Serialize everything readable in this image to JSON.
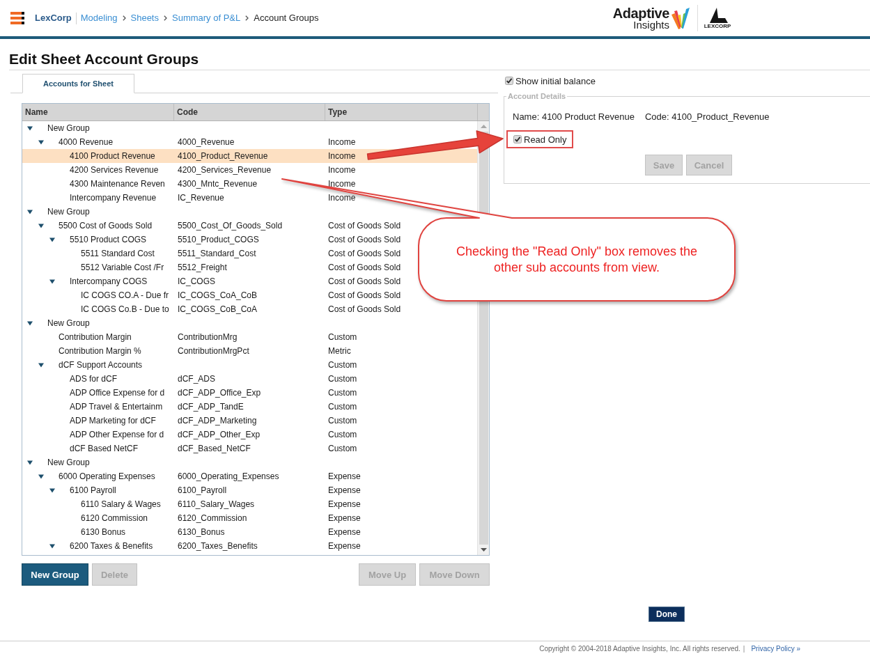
{
  "header": {
    "breadcrumbs": [
      {
        "label": "LexCorp",
        "kind": "home"
      },
      {
        "label": "Modeling",
        "kind": "link"
      },
      {
        "label": "Sheets",
        "kind": "link"
      },
      {
        "label": "Summary of P&L",
        "kind": "link"
      },
      {
        "label": "Account Groups",
        "kind": "current"
      }
    ],
    "brand_logo": {
      "line_1": "Adaptive",
      "line_2": "Insights"
    },
    "client_logo": {
      "text": "LEXCORP"
    }
  },
  "page_title": "Edit Sheet Account Groups",
  "tabs": [
    {
      "label": "Accounts for Sheet",
      "selected": true
    }
  ],
  "tree": {
    "columns": [
      "Name",
      "Code",
      "Type"
    ],
    "rows": [
      {
        "name": "New Group",
        "selected": false,
        "expanded": true,
        "children": [
          {
            "name": "4000 Revenue",
            "code": "4000_Revenue",
            "type": "Income",
            "selected": false,
            "expanded": true,
            "children": [
              {
                "name": "4100 Product Revenue",
                "code": "4100_Product_Revenue",
                "type": "Income",
                "selected": true
              },
              {
                "name": "4200 Services Revenue",
                "code": "4200_Services_Revenue",
                "type": "Income",
                "selected": false
              },
              {
                "name": "4300 Maintenance Reven",
                "code": "4300_Mntc_Revenue",
                "type": "Income",
                "selected": false
              },
              {
                "name": "Intercompany Revenue",
                "code": "IC_Revenue",
                "type": "Income",
                "selected": false
              }
            ]
          }
        ]
      },
      {
        "name": "New Group",
        "selected": false,
        "expanded": true,
        "children": [
          {
            "name": "5500 Cost of Goods Sold",
            "code": "5500_Cost_Of_Goods_Sold",
            "type": "Cost of Goods Sold",
            "selected": false,
            "expanded": true,
            "children": [
              {
                "name": "5510 Product COGS",
                "code": "5510_Product_COGS",
                "type": "Cost of Goods Sold",
                "selected": false,
                "expanded": true,
                "children": [
                  {
                    "name": "5511 Standard Cost",
                    "code": "5511_Standard_Cost",
                    "type": "Cost of Goods Sold",
                    "selected": false
                  },
                  {
                    "name": "5512 Variable Cost /Fr",
                    "code": "5512_Freight",
                    "type": "Cost of Goods Sold",
                    "selected": false
                  }
                ]
              },
              {
                "name": "Intercompany COGS",
                "code": "IC_COGS",
                "type": "Cost of Goods Sold",
                "selected": false,
                "expanded": true,
                "children": [
                  {
                    "name": "IC COGS CO.A - Due fr",
                    "code": "IC_COGS_CoA_CoB",
                    "type": "Cost of Goods Sold",
                    "selected": false
                  },
                  {
                    "name": "IC COGS Co.B - Due to",
                    "code": "IC_COGS_CoB_CoA",
                    "type": "Cost of Goods Sold",
                    "selected": false
                  }
                ]
              }
            ]
          }
        ]
      },
      {
        "name": "New Group",
        "selected": false,
        "expanded": true,
        "children": [
          {
            "name": "Contribution Margin",
            "code": "ContributionMrg",
            "type": "Custom",
            "selected": false
          },
          {
            "name": "Contribution Margin %",
            "code": "ContributionMrgPct",
            "type": "Metric",
            "selected": false
          },
          {
            "name": "dCF Support Accounts",
            "type": "Custom",
            "selected": false,
            "expanded": true,
            "children": [
              {
                "name": "ADS for dCF",
                "code": "dCF_ADS",
                "type": "Custom",
                "selected": false
              },
              {
                "name": "ADP Office Expense for d",
                "code": "dCF_ADP_Office_Exp",
                "type": "Custom",
                "selected": false
              },
              {
                "name": "ADP Travel & Entertainm",
                "code": "dCF_ADP_TandE",
                "type": "Custom",
                "selected": false
              },
              {
                "name": "ADP Marketing for dCF",
                "code": "dCF_ADP_Marketing",
                "type": "Custom",
                "selected": false
              },
              {
                "name": "ADP Other Expense for d",
                "code": "dCF_ADP_Other_Exp",
                "type": "Custom",
                "selected": false
              },
              {
                "name": "dCF Based NetCF",
                "code": "dCF_Based_NetCF",
                "type": "Custom",
                "selected": false
              }
            ]
          }
        ]
      },
      {
        "name": "New Group",
        "selected": false,
        "expanded": true,
        "children": [
          {
            "name": "6000 Operating Expenses",
            "code": "6000_Operating_Expenses",
            "type": "Expense",
            "selected": false,
            "expanded": true,
            "children": [
              {
                "name": "6100 Payroll",
                "code": "6100_Payroll",
                "type": "Expense",
                "selected": false,
                "expanded": true,
                "children": [
                  {
                    "name": "6110 Salary & Wages",
                    "code": "6110_Salary_Wages",
                    "type": "Expense",
                    "selected": false
                  },
                  {
                    "name": "6120 Commission",
                    "code": "6120_Commission",
                    "type": "Expense",
                    "selected": false
                  },
                  {
                    "name": "6130 Bonus",
                    "code": "6130_Bonus",
                    "type": "Expense",
                    "selected": false
                  }
                ]
              },
              {
                "name": "6200 Taxes & Benefits",
                "code": "6200_Taxes_Benefits",
                "type": "Expense",
                "selected": false,
                "expanded": true
              }
            ]
          }
        ]
      }
    ]
  },
  "group_buttons": [
    {
      "label": "New Group",
      "disabled": false
    },
    {
      "label": "Delete",
      "disabled": true
    }
  ],
  "move_buttons": [
    {
      "label": "Move Up",
      "disabled": true
    },
    {
      "label": "Move Down",
      "disabled": true
    }
  ],
  "show_initial_balance": {
    "label": "Show initial balance",
    "checked": true
  },
  "account_details": {
    "legend": "Account Details",
    "name": "Name: 4100 Product Revenue",
    "code": "Code: 4100_Product_Revenue",
    "read_only": {
      "label": "Read Only",
      "checked": true,
      "highlighted": true
    },
    "buttons": [
      {
        "label": "Save",
        "disabled": true
      },
      {
        "label": "Cancel",
        "disabled": true
      }
    ]
  },
  "done_button": {
    "label": "Done",
    "disabled": false
  },
  "annotations": [
    {
      "kind": "arrow"
    },
    {
      "kind": "callout",
      "text": "Checking the \"Read Only\" box removes the other sub accounts from view."
    }
  ],
  "footer": {
    "copyright": "Copyright © 2004-2018 Adaptive Insights, Inc. All rights reserved.",
    "separator": "|",
    "link": "Privacy Policy »"
  }
}
